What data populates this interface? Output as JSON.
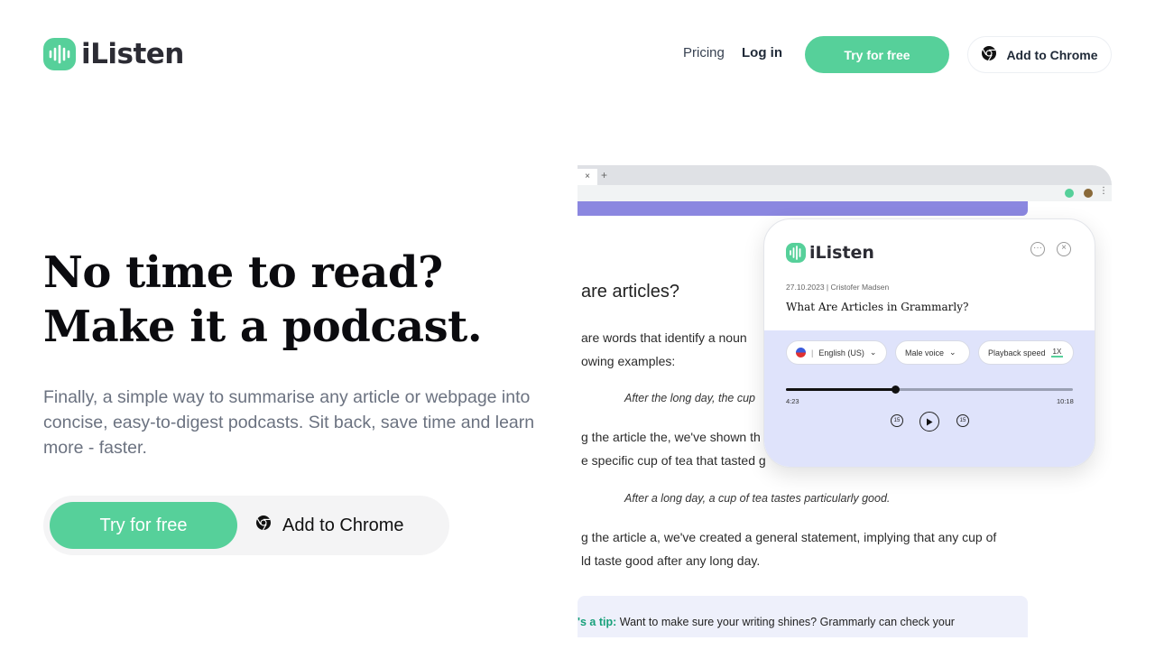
{
  "nav": {
    "brand": "iListen",
    "pricing": "Pricing",
    "login": "Log in",
    "try_free": "Try for free",
    "add_chrome": "Add to Chrome"
  },
  "hero": {
    "title_line1": "No time to read?",
    "title_line2": "Make it a podcast.",
    "subtitle": "Finally, a simple way to summarise any article or webpage into concise, easy-to-digest podcasts. Sit back, save time and learn more - faster.",
    "cta_try": "Try for free",
    "cta_chrome": "Add to Chrome"
  },
  "colors": {
    "accent": "#56d09a",
    "player_panel": "#dfe3fb",
    "browser_bar": "#dfe1e5"
  },
  "screenshot": {
    "tab_close": "×",
    "tab_new": "+",
    "article": {
      "heading": "are articles?",
      "p1": "are words that identify a noun",
      "p1b": "owing examples:",
      "quote1": "After the long day, the cup",
      "p2": "g the article the, we've shown th",
      "p2b": "e specific cup of tea that tasted g",
      "quote2": "After a long day, a cup of tea tastes particularly good.",
      "p3": "g the article a, we've created a general statement, implying that any cup of",
      "p3b": "ld taste good after any long day.",
      "tip_label": "'s a tip:",
      "tip_text": "Want to make sure your writing shines? Grammarly can check your"
    },
    "player": {
      "brand": "iListen",
      "date": "27.10.2023 | Cristofer Madsen",
      "title": "What Are Articles in Grammarly?",
      "language": "English (US)",
      "voice": "Male voice",
      "speed_label": "Playback speed",
      "speed_value": "1X",
      "time_current": "4:23",
      "time_total": "10:18",
      "progress_fraction": 0.38,
      "skip_back": "15",
      "skip_fwd": "15"
    }
  }
}
